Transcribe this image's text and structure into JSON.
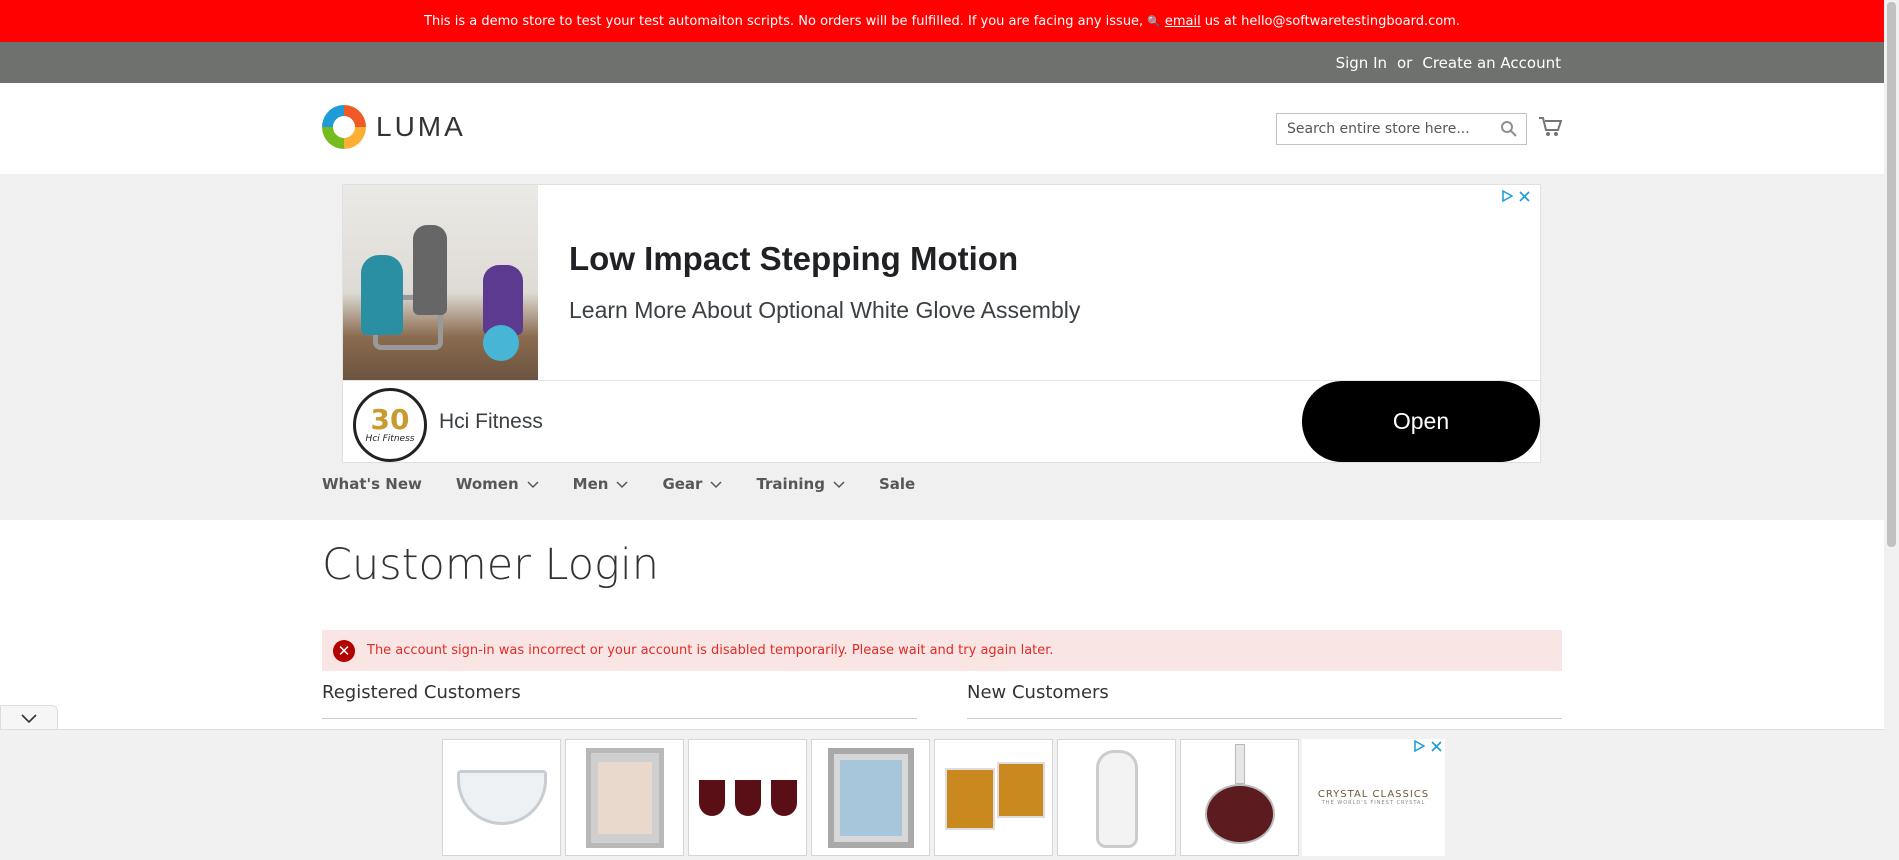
{
  "demo_banner": {
    "text_before": "This is a demo store to test your test automaiton scripts. No orders will be fulfilled. If you are facing any issue,",
    "link": "email",
    "text_after": "us at hello@softwaretestingboard.com."
  },
  "header_links": {
    "sign_in": "Sign In",
    "or": "or",
    "create_account": "Create an Account"
  },
  "logo": {
    "text": "LUMA"
  },
  "search": {
    "placeholder": "Search entire store here..."
  },
  "ad": {
    "headline": "Low Impact Stepping Motion",
    "subline": "Learn More About Optional White Glove Assembly",
    "badge_number": "30",
    "badge_name": "Hci Fitness",
    "brand": "Hci Fitness",
    "cta": "Open"
  },
  "nav": {
    "items": [
      {
        "label": "What's New",
        "has_dropdown": false
      },
      {
        "label": "Women",
        "has_dropdown": true
      },
      {
        "label": "Men",
        "has_dropdown": true
      },
      {
        "label": "Gear",
        "has_dropdown": true
      },
      {
        "label": "Training",
        "has_dropdown": true
      },
      {
        "label": "Sale",
        "has_dropdown": false
      }
    ]
  },
  "page": {
    "title": "Customer Login",
    "error_message": "The account sign-in was incorrect or your account is disabled temporarily. Please wait and try again later.",
    "registered_customers": "Registered Customers",
    "new_customers": "New Customers"
  },
  "bottom_ad": {
    "brand": "CRYSTAL CLASSICS",
    "tagline": "THE WORLD'S FINEST CRYSTAL"
  },
  "colors": {
    "banner": "#ff0101",
    "panel": "#6e716e",
    "error_bg": "#fae5e5",
    "error_text": "#e02b27"
  }
}
